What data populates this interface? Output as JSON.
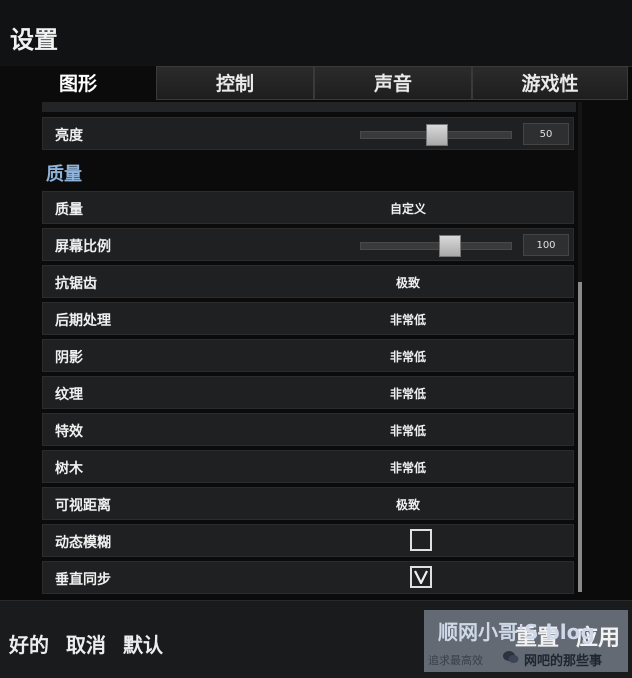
{
  "window": {
    "title": "设置"
  },
  "tabs": [
    {
      "label": "图形"
    },
    {
      "label": "控制"
    },
    {
      "label": "声音"
    },
    {
      "label": "游戏性"
    }
  ],
  "brightness": {
    "label": "亮度",
    "value": "50",
    "level": 0.5
  },
  "section": {
    "heading": "质量"
  },
  "quality": {
    "label": "质量",
    "value": "自定义"
  },
  "screen_scale": {
    "label": "屏幕比例",
    "value": "100",
    "level": 0.6
  },
  "options": [
    {
      "label": "抗锯齿",
      "value": "极致"
    },
    {
      "label": "后期处理",
      "value": "非常低"
    },
    {
      "label": "阴影",
      "value": "非常低"
    },
    {
      "label": "纹理",
      "value": "非常低"
    },
    {
      "label": "特效",
      "value": "非常低"
    },
    {
      "label": "树木",
      "value": "非常低"
    },
    {
      "label": "可视距离",
      "value": "极致"
    }
  ],
  "motion_blur": {
    "label": "动态模糊",
    "checked": false
  },
  "vsync": {
    "label": "垂直同步",
    "checked": true
  },
  "footer": {
    "ok": "好的",
    "cancel": "取消",
    "default": "默认",
    "reset": "重置",
    "apply": "应用"
  },
  "watermark": {
    "title": "顺网小哥'S blog",
    "subtitle": "追求最高效",
    "account": "网吧的那些事"
  }
}
